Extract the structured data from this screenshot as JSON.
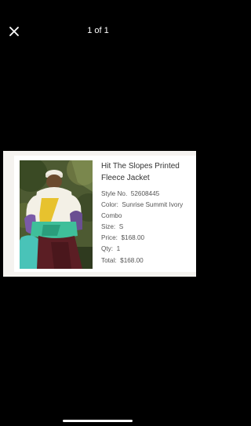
{
  "viewer": {
    "counter": "1 of 1",
    "close_icon": "close-icon"
  },
  "product": {
    "name": "Hit The Slopes Printed Fleece Jacket",
    "style_label": "Style No.",
    "style_no": "52608445",
    "color_label": "Color:",
    "color": "Sunrise Summit Ivory Combo",
    "size_label": "Size:",
    "size": "S",
    "price_label": "Price:",
    "price": "$168.00",
    "qty_label": "Qty:",
    "qty": "1",
    "total_label": "Total:",
    "total": "$168.00"
  },
  "colors": {
    "background": "#000000",
    "card": "#ffffff",
    "text": "#555555"
  }
}
